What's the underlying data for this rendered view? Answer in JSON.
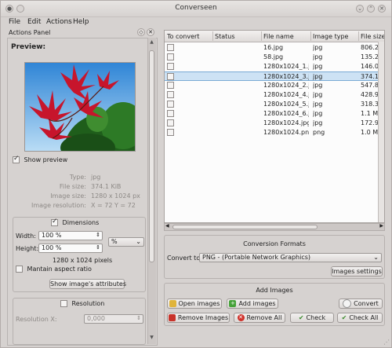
{
  "window": {
    "title": "Converseen"
  },
  "menu": [
    "File",
    "Edit",
    "Actions",
    "Help"
  ],
  "actions_panel": {
    "header": "Actions Panel",
    "preview_label": "Preview:",
    "show_preview_label": "Show preview",
    "show_preview_checked": true,
    "info": [
      {
        "label": "Type:",
        "value": "jpg"
      },
      {
        "label": "File size:",
        "value": "374.1 KiB"
      },
      {
        "label": "Image size:",
        "value": "1280 x 1024 px"
      },
      {
        "label": "Image resolution:",
        "value": "X = 72 Y = 72"
      }
    ],
    "dimensions": {
      "label": "Dimensions",
      "checked": true,
      "width_label": "Width:",
      "width_value": "100 %",
      "height_label": "Height:",
      "height_value": "100 %",
      "unit": "%",
      "pixels_text": "1280 x 1024 pixels",
      "aspect_label": "Mantain aspect ratio",
      "aspect_checked": false,
      "attributes_button": "Show image's attributes"
    },
    "resolution": {
      "label": "Resolution",
      "checked": false,
      "x_label": "Resolution X:",
      "x_value": "0,000"
    }
  },
  "table": {
    "columns": [
      "To convert",
      "Status",
      "File name",
      "Image type",
      "File size"
    ],
    "rows": [
      {
        "file": "16.jpg",
        "type": "jpg",
        "size": "806.2 KiB",
        "selected": false
      },
      {
        "file": "58.jpg",
        "type": "jpg",
        "size": "135.2 KiB",
        "selected": false
      },
      {
        "file": "1280x1024_1.jpg",
        "type": "jpg",
        "size": "146.0 KiB",
        "selected": false
      },
      {
        "file": "1280x1024_3.j...",
        "type": "jpg",
        "size": "374.1 KiB",
        "selected": true
      },
      {
        "file": "1280x1024_2.j...",
        "type": "jpg",
        "size": "547.8 KiB",
        "selected": false
      },
      {
        "file": "1280x1024_4.j...",
        "type": "jpg",
        "size": "428.9 KiB",
        "selected": false
      },
      {
        "file": "1280x1024_5.j...",
        "type": "jpg",
        "size": "318.3 KiB",
        "selected": false
      },
      {
        "file": "1280x1024_6.j...",
        "type": "jpg",
        "size": "1.1 MiB",
        "selected": false
      },
      {
        "file": "1280x1024.jpg",
        "type": "jpg",
        "size": "172.9 KiB",
        "selected": false
      },
      {
        "file": "1280x1024.png",
        "type": "png",
        "size": "1.0 MiB",
        "selected": false
      }
    ]
  },
  "conversion": {
    "title": "Conversion Formats",
    "convert_to_label": "Convert to:",
    "format_value": "PNG - (Portable Network Graphics)",
    "image_settings_button": "Images settings"
  },
  "add_images": {
    "title": "Add Images",
    "open_button": "Open images",
    "add_button": "Add images",
    "convert_button": "Convert",
    "remove_button": "Remove Images",
    "remove_all_button": "Remove All",
    "check_button": "Check",
    "check_all_button": "Check All"
  }
}
